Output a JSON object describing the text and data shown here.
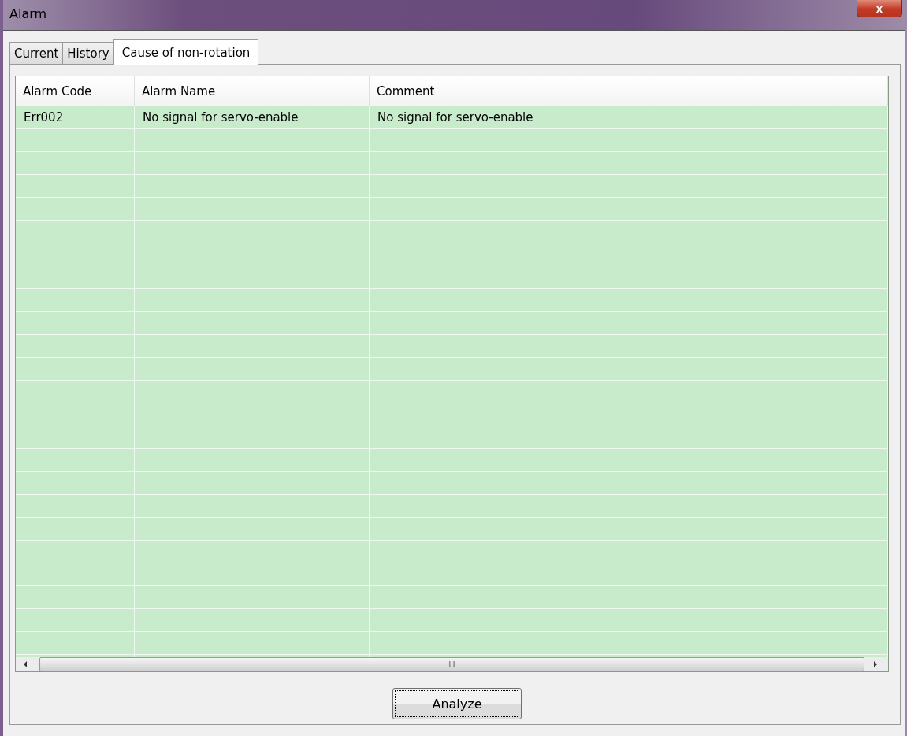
{
  "window": {
    "title": "Alarm",
    "close": "x"
  },
  "tabs": [
    {
      "label": "Current",
      "selected": false
    },
    {
      "label": "History",
      "selected": false
    },
    {
      "label": "Cause of non-rotation",
      "selected": true
    }
  ],
  "table": {
    "columns": [
      "Alarm Code",
      "Alarm Name",
      "Comment"
    ],
    "rows": [
      [
        "Err002",
        "No signal for servo-enable",
        "No signal for servo-enable"
      ]
    ]
  },
  "scrollbar": {
    "grip": "III"
  },
  "buttons": [
    {
      "label": "Analyze"
    }
  ]
}
